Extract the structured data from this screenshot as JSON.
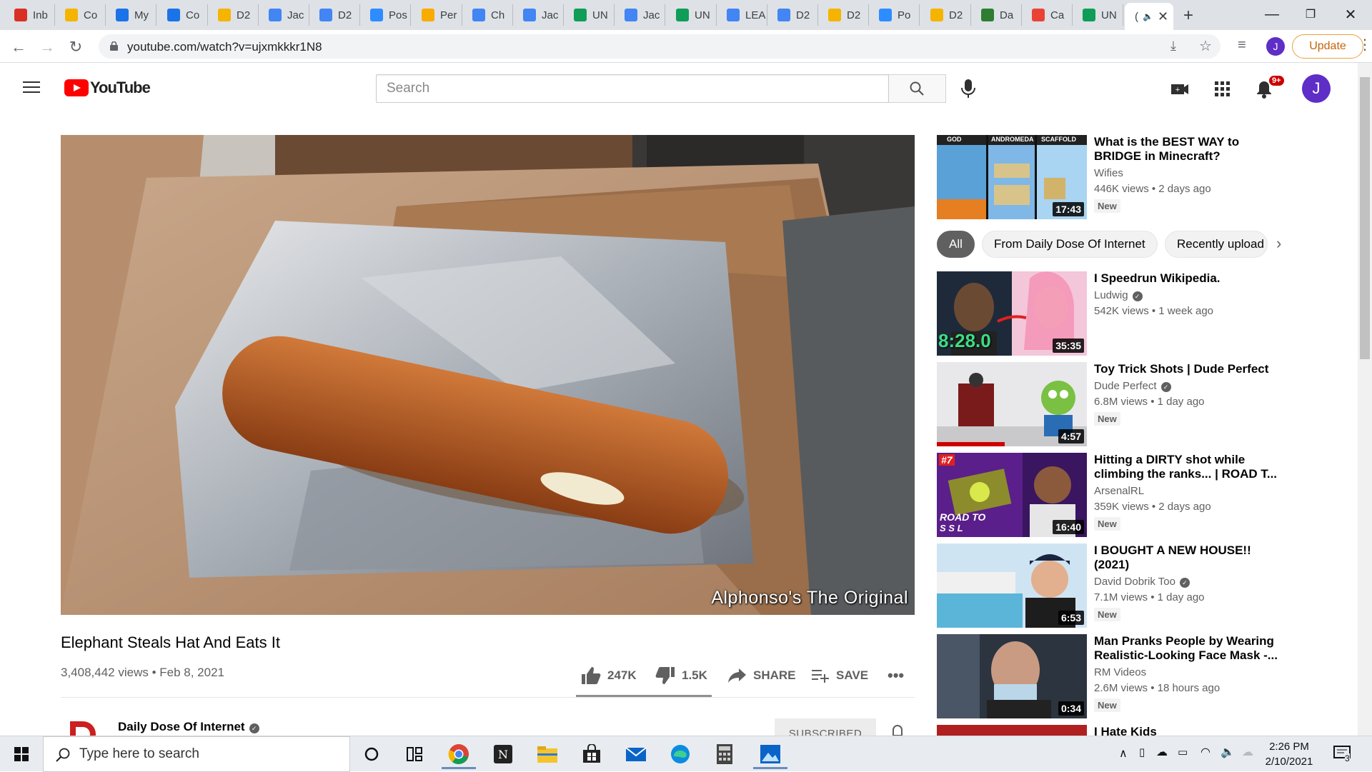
{
  "browser": {
    "tabs": [
      {
        "label": "Inb",
        "color": "#d93025"
      },
      {
        "label": "Co",
        "color": "#f4b400"
      },
      {
        "label": "My",
        "color": "#1a73e8"
      },
      {
        "label": "Co",
        "color": "#1a73e8"
      },
      {
        "label": "D2",
        "color": "#f4b400"
      },
      {
        "label": "Jac",
        "color": "#4285f4"
      },
      {
        "label": "D2",
        "color": "#4285f4"
      },
      {
        "label": "Pos",
        "color": "#2d8cff"
      },
      {
        "label": "Per",
        "color": "#f9ab00"
      },
      {
        "label": "Ch",
        "color": "#4285f4"
      },
      {
        "label": "Jac",
        "color": "#4285f4"
      },
      {
        "label": "UN",
        "color": "#0f9d58"
      },
      {
        "label": "Jac",
        "color": "#4285f4"
      },
      {
        "label": "UN",
        "color": "#0f9d58"
      },
      {
        "label": "LEA",
        "color": "#4285f4"
      },
      {
        "label": "D2",
        "color": "#4285f4"
      },
      {
        "label": "D2",
        "color": "#f4b400"
      },
      {
        "label": "Po",
        "color": "#2d8cff"
      },
      {
        "label": "D2",
        "color": "#f4b400"
      },
      {
        "label": "Da",
        "color": "#2e7d32"
      },
      {
        "label": "Ca",
        "color": "#ea4335"
      },
      {
        "label": "UN",
        "color": "#0f9d58"
      }
    ],
    "active_tab_label": "(",
    "url": "youtube.com/watch?v=ujxmkkkr1N8",
    "update_label": "Update",
    "profile_initial": "J"
  },
  "youtube": {
    "logo_text": "YouTube",
    "search_placeholder": "Search",
    "notification_count": "9+",
    "avatar_initial": "J",
    "video": {
      "caption": "Alphonso's The Original",
      "title": "Elephant Steals Hat And Eats It",
      "meta": "3,408,442 views • Feb 8, 2021",
      "likes": "247K",
      "dislikes": "1.5K",
      "share": "SHARE",
      "save": "SAVE",
      "channel": "Daily Dose Of Internet",
      "subscribed": "SUBSCRIBED"
    },
    "chips": [
      "All",
      "From Daily Dose Of Internet",
      "Recently upload"
    ],
    "recommendations": [
      {
        "title": "What is the BEST WAY to BRIDGE in Minecraft?",
        "channel": "Wifies",
        "meta": "446K views • 2 days ago",
        "duration": "17:43",
        "badge": "New",
        "verified": false
      },
      {
        "title": "I Speedrun Wikipedia.",
        "channel": "Ludwig",
        "meta": "542K views • 1 week ago",
        "duration": "35:35",
        "badge": "",
        "verified": true
      },
      {
        "title": "Toy Trick Shots | Dude Perfect",
        "channel": "Dude Perfect",
        "meta": "6.8M views • 1 day ago",
        "duration": "4:57",
        "badge": "New",
        "verified": true
      },
      {
        "title": "Hitting a DIRTY shot while climbing the ranks... | ROAD T...",
        "channel": "ArsenalRL",
        "meta": "359K views • 2 days ago",
        "duration": "16:40",
        "badge": "New",
        "verified": false
      },
      {
        "title": "I BOUGHT A NEW HOUSE!! (2021)",
        "channel": "David Dobrik Too",
        "meta": "7.1M views • 1 day ago",
        "duration": "6:53",
        "badge": "New",
        "verified": true
      },
      {
        "title": "Man Pranks People by Wearing Realistic-Looking Face Mask -...",
        "channel": "RM Videos",
        "meta": "2.6M views • 18 hours ago",
        "duration": "0:34",
        "badge": "New",
        "verified": false
      },
      {
        "title": "I Hate Kids",
        "channel": "",
        "meta": "",
        "duration": "",
        "badge": "",
        "verified": false
      }
    ],
    "thumb_text": {
      "minecraft": [
        "GOD",
        "ANDROMEDA",
        "SCAFFOLD"
      ],
      "speedrun_timer": "8:28.0",
      "rl_rank": "#7",
      "rl_road": "ROAD TO",
      "rl_ssl": "S S L"
    }
  },
  "taskbar": {
    "search_placeholder": "Type here to search",
    "time": "2:26 PM",
    "date": "2/10/2021",
    "notif_count": "3"
  }
}
